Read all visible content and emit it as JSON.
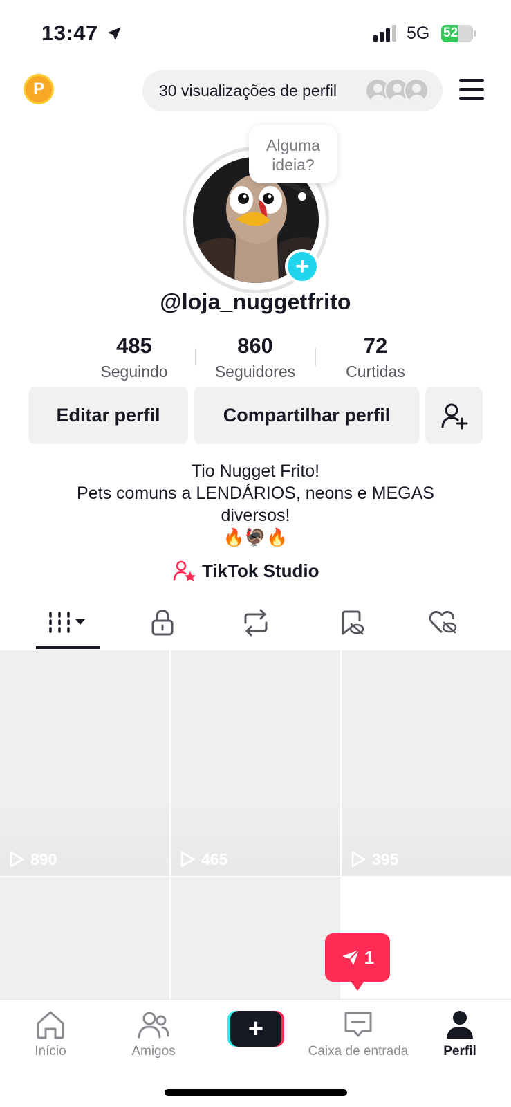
{
  "status_bar": {
    "time": "13:47",
    "network": "5G",
    "battery": "52",
    "battery_level": 0.52
  },
  "header": {
    "coin_letter": "P",
    "views_text": "30 visualizações de perfil"
  },
  "profile": {
    "thought_bubble": "Alguma ideia?",
    "add_badge": "+",
    "username": "@loja_nuggetfrito",
    "stats": [
      {
        "value": "485",
        "label": "Seguindo"
      },
      {
        "value": "860",
        "label": "Seguidores"
      },
      {
        "value": "72",
        "label": "Curtidas"
      }
    ],
    "buttons": {
      "edit": "Editar perfil",
      "share": "Compartilhar perfil"
    },
    "bio": {
      "line1": "Tio Nugget Frito!",
      "line2": "Pets comuns a LENDÁRIOS, neons e MEGAS diversos!",
      "emojis": "🔥🦃🔥"
    },
    "studio_link": "TikTok Studio"
  },
  "tabs": [
    {
      "name": "videos",
      "icon": "grid-icon",
      "active": true
    },
    {
      "name": "private",
      "icon": "lock-icon"
    },
    {
      "name": "reposts",
      "icon": "repost-icon"
    },
    {
      "name": "saved",
      "icon": "bookmark-hidden-icon"
    },
    {
      "name": "liked",
      "icon": "heart-hidden-icon"
    }
  ],
  "videos": [
    {
      "views": "890"
    },
    {
      "views": "465"
    },
    {
      "views": "395"
    },
    {
      "views": ""
    },
    {
      "views": ""
    }
  ],
  "inbox_badge": "1",
  "bottom_nav": {
    "home": "Início",
    "friends": "Amigos",
    "create": "+",
    "inbox": "Caixa de entrada",
    "profile": "Perfil"
  },
  "colors": {
    "accent_red": "#fe2c55",
    "accent_cyan": "#20d5ec",
    "coin_orange": "#f9a825",
    "battery_green": "#34c759"
  }
}
